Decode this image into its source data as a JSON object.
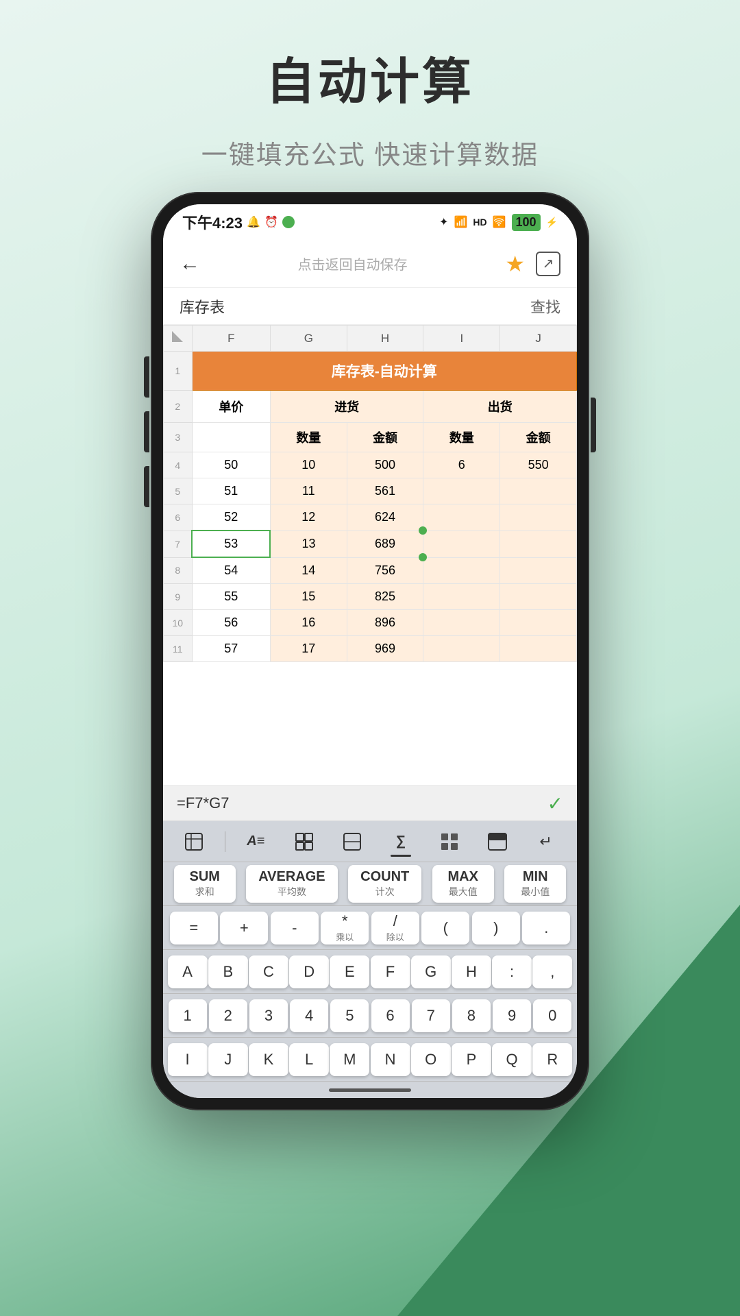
{
  "page": {
    "title": "自动计算",
    "subtitle": "一键填充公式 快速计算数据"
  },
  "status_bar": {
    "time": "下午4:23",
    "battery": "100",
    "icons": "🔔 ⏰ 📱 ✦ 📶 📶 🛜"
  },
  "nav": {
    "back_label": "←",
    "center_text": "点击返回自动保存",
    "star_icon": "★",
    "export_icon": "↗"
  },
  "sheet": {
    "name": "库存表",
    "find_label": "查找",
    "table_title": "库存表-自动计算",
    "columns": [
      "F",
      "G",
      "H",
      "I",
      "J"
    ],
    "subheaders": {
      "row2": [
        "单价",
        "进货",
        "出货"
      ],
      "row3": [
        "数量",
        "金额",
        "数量",
        "金额"
      ]
    },
    "rows": [
      {
        "num": 4,
        "cells": [
          "50",
          "10",
          "500",
          "6",
          "550"
        ]
      },
      {
        "num": 5,
        "cells": [
          "51",
          "11",
          "561",
          "",
          ""
        ]
      },
      {
        "num": 6,
        "cells": [
          "52",
          "12",
          "624",
          "",
          ""
        ]
      },
      {
        "num": 7,
        "cells": [
          "53",
          "13",
          "689",
          "",
          ""
        ],
        "selected_col": 0
      },
      {
        "num": 8,
        "cells": [
          "54",
          "14",
          "756",
          "",
          ""
        ]
      },
      {
        "num": 9,
        "cells": [
          "55",
          "15",
          "825",
          "",
          ""
        ]
      },
      {
        "num": 10,
        "cells": [
          "56",
          "16",
          "896",
          "",
          ""
        ]
      },
      {
        "num": 11,
        "cells": [
          "57",
          "17",
          "969",
          "",
          ""
        ]
      }
    ]
  },
  "formula_bar": {
    "formula": "=F7*G7",
    "confirm_icon": "✓"
  },
  "keyboard": {
    "toolbar_icons": [
      "⊟",
      "A≡",
      "⊞",
      "⊡",
      "∑",
      "⊟⊞",
      "⊡⊟",
      "↵"
    ],
    "functions": [
      {
        "name": "SUM",
        "sub": "求和"
      },
      {
        "name": "AVERAGE",
        "sub": "平均数"
      },
      {
        "name": "COUNT",
        "sub": "计次"
      },
      {
        "name": "MAX",
        "sub": "最大值"
      },
      {
        "name": "MIN",
        "sub": "最小值"
      }
    ],
    "symbols": [
      "=",
      "+",
      "-",
      "*\n乘以",
      "/\n除以",
      "(",
      ")",
      "."
    ],
    "alpha_row1": [
      "A",
      "B",
      "C",
      "D",
      "E",
      "F",
      "G",
      "H",
      ":",
      ","
    ],
    "number_row": [
      "1",
      "2",
      "3",
      "4",
      "5",
      "6",
      "7",
      "8",
      "9",
      "0"
    ],
    "alpha_row2": [
      "I",
      "J",
      "K",
      "L",
      "M",
      "N",
      "O",
      "P",
      "Q",
      "R"
    ]
  }
}
